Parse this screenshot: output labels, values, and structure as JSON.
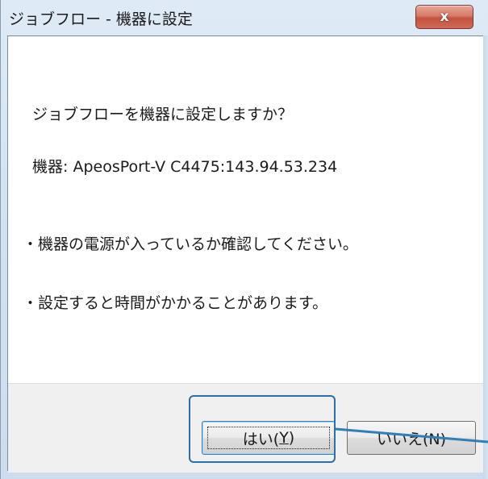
{
  "window": {
    "title": "ジョブフロー - 機器に設定",
    "close_label": "x"
  },
  "message": {
    "question": "ジョブフローを機器に設定しますか？",
    "device_label": "機器: ApeosPort-V C4475:143.94.53.234",
    "note1": "・機器の電源が入っているか確認してください。",
    "note2": "・設定すると時間がかかることがあります。"
  },
  "buttons": {
    "yes_prefix": "はい(",
    "yes_key": "Y",
    "yes_suffix": ")",
    "no_label": "いいえ(N)"
  },
  "colors": {
    "highlight": "#2a6fa8",
    "callout_line": "#2f7fb8"
  }
}
